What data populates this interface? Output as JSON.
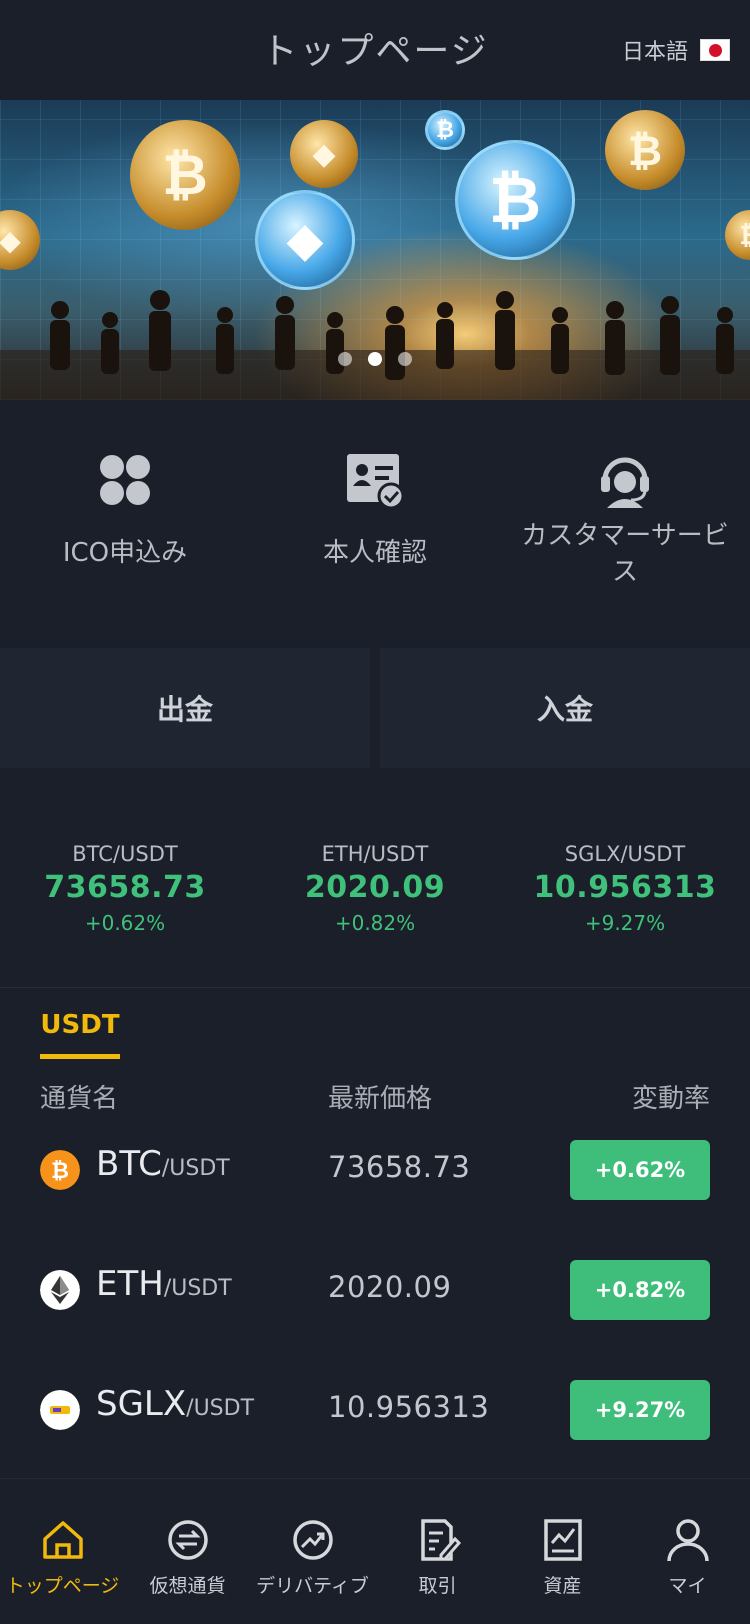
{
  "header": {
    "title": "トップページ",
    "language": "日本語",
    "flag_icon": "japan-flag-icon"
  },
  "banner": {
    "slides": 3,
    "active_slide": 1
  },
  "quick_actions": [
    {
      "label": "ICO申込み",
      "icon": "grid-four-icon"
    },
    {
      "label": "本人確認",
      "icon": "id-card-check-icon"
    },
    {
      "label": "カスタマーサービス",
      "icon": "headset-support-icon"
    }
  ],
  "funds": {
    "withdraw": "出金",
    "deposit": "入金"
  },
  "ticker": [
    {
      "pair": "BTC/USDT",
      "price": "73658.73",
      "change": "+0.62%"
    },
    {
      "pair": "ETH/USDT",
      "price": "2020.09",
      "change": "+0.82%"
    },
    {
      "pair": "SGLX/USDT",
      "price": "10.956313",
      "change": "+9.27%"
    }
  ],
  "market": {
    "tab": "USDT",
    "columns": {
      "name": "通貨名",
      "price": "最新価格",
      "change": "変動率"
    },
    "rows": [
      {
        "base": "BTC",
        "quote": "/USDT",
        "price": "73658.73",
        "change": "+0.62%",
        "icon": "bitcoin-icon"
      },
      {
        "base": "ETH",
        "quote": "/USDT",
        "price": "2020.09",
        "change": "+0.82%",
        "icon": "ethereum-icon"
      },
      {
        "base": "SGLX",
        "quote": "/USDT",
        "price": "10.956313",
        "change": "+9.27%",
        "icon": "sglx-icon"
      }
    ]
  },
  "nav": [
    {
      "label": "トップページ",
      "icon": "home-icon",
      "active": true
    },
    {
      "label": "仮想通貨",
      "icon": "exchange-icon",
      "active": false
    },
    {
      "label": "デリバティブ",
      "icon": "trend-chart-icon",
      "active": false
    },
    {
      "label": "取引",
      "icon": "order-document-icon",
      "active": false
    },
    {
      "label": "資産",
      "icon": "assets-chart-icon",
      "active": false
    },
    {
      "label": "マイ",
      "icon": "user-icon",
      "active": false
    }
  ],
  "colors": {
    "accent": "#f0b90b",
    "positive": "#3fbd7a",
    "background": "#1a1f29"
  }
}
